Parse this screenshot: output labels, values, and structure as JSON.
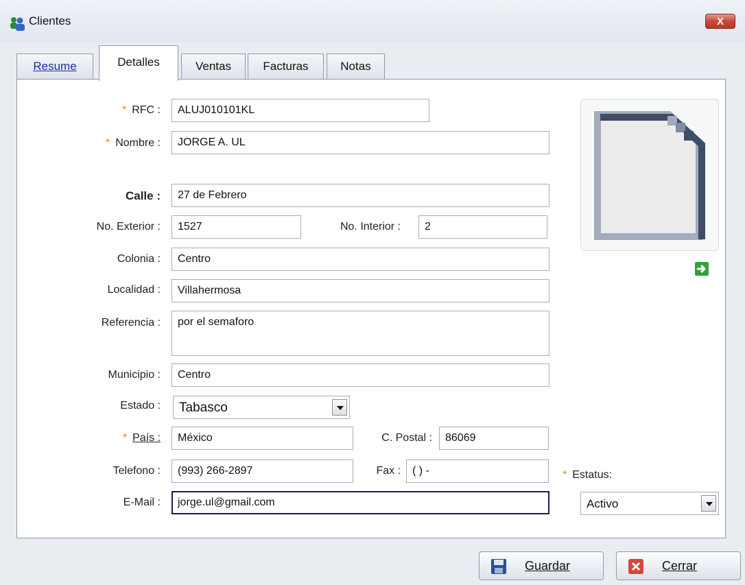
{
  "window": {
    "title": "Clientes",
    "close_label": "X"
  },
  "tabs": [
    {
      "label": "Resume",
      "active": false
    },
    {
      "label": "Detalles",
      "active": true
    },
    {
      "label": "Ventas",
      "active": false
    },
    {
      "label": "Facturas",
      "active": false
    },
    {
      "label": "Notas",
      "active": false
    }
  ],
  "form": {
    "rfc": {
      "label": "RFC :",
      "value": "ALUJ010101KL",
      "required": true
    },
    "nombre": {
      "label": "Nombre :",
      "value": "JORGE A. UL",
      "required": true
    },
    "calle": {
      "label": "Calle :",
      "value": "27 de Febrero"
    },
    "no_exterior": {
      "label": "No. Exterior :",
      "value": "1527"
    },
    "no_interior": {
      "label": "No. Interior :",
      "value": "2"
    },
    "colonia": {
      "label": "Colonia :",
      "value": "Centro"
    },
    "localidad": {
      "label": "Localidad :",
      "value": "Villahermosa"
    },
    "referencia": {
      "label": "Referencia :",
      "value": "por el semaforo"
    },
    "municipio": {
      "label": "Municipio :",
      "value": "Centro"
    },
    "estado": {
      "label": "Estado :",
      "value": "Tabasco"
    },
    "pais": {
      "label": "País :",
      "value": "México",
      "required": true
    },
    "c_postal": {
      "label": "C. Postal :",
      "value": "86069"
    },
    "telefono": {
      "label": "Telefono :",
      "value": "(993) 266-2897"
    },
    "fax": {
      "label": "Fax :",
      "value": "(  )   -"
    },
    "email": {
      "label": "E-Mail :",
      "value": "jorge.ul@gmail.com"
    },
    "estatus": {
      "label": "Estatus:",
      "value": "Activo",
      "required": true
    }
  },
  "required_marker": "*",
  "buttons": {
    "save": "Guardar",
    "close": "Cerrar"
  },
  "icons": {
    "app": "users-icon",
    "photo": "blank-document-icon",
    "load_photo": "green-arrow-right-icon",
    "save": "floppy-disk-icon",
    "close": "red-x-icon"
  },
  "colors": {
    "required_star": "#e58a1a",
    "link": "#1a2ea8",
    "close_red": "#c8493a",
    "arrow_green": "#2fa23a"
  }
}
